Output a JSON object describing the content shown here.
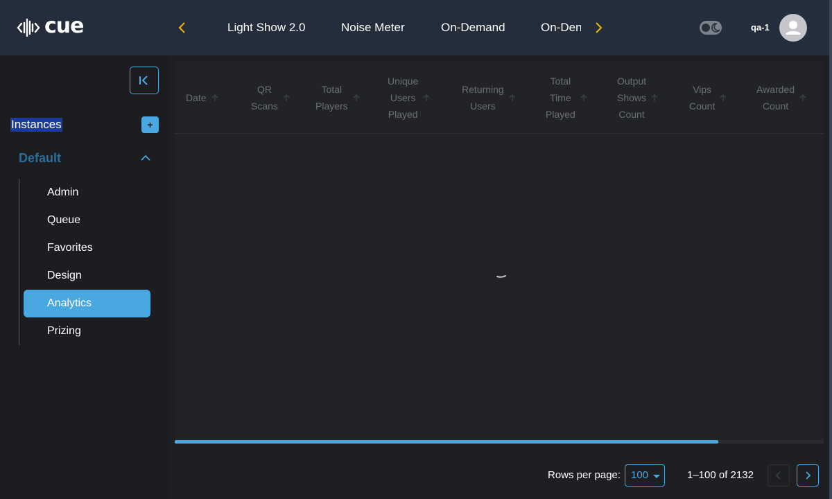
{
  "brand": {
    "name": "cue"
  },
  "header": {
    "tabs": [
      {
        "label": "Light Show 2.0"
      },
      {
        "label": "Noise Meter"
      },
      {
        "label": "On-Demand"
      },
      {
        "label": "On-Den"
      }
    ],
    "username": "qa-1",
    "colors": {
      "arrow": "#f2b705",
      "bar": "#242d3b"
    }
  },
  "sidebar": {
    "instances_label": "Instances",
    "add_label": "+",
    "group": {
      "label": "Default",
      "expanded": true
    },
    "items": [
      {
        "label": "Admin",
        "active": false
      },
      {
        "label": "Queue",
        "active": false
      },
      {
        "label": "Favorites",
        "active": false
      },
      {
        "label": "Design",
        "active": false
      },
      {
        "label": "Analytics",
        "active": true
      },
      {
        "label": "Prizing",
        "active": false
      }
    ]
  },
  "table": {
    "columns": [
      {
        "lines": [
          "Date"
        ]
      },
      {
        "lines": [
          "QR",
          "Scans"
        ]
      },
      {
        "lines": [
          "Total",
          "Players"
        ]
      },
      {
        "lines": [
          "Unique",
          "Users",
          "Played"
        ]
      },
      {
        "lines": [
          "Returning",
          "Users"
        ]
      },
      {
        "lines": [
          "Total",
          "Time",
          "Played"
        ]
      },
      {
        "lines": [
          "Output",
          "Shows",
          "Count"
        ]
      },
      {
        "lines": [
          "Vips",
          "Count"
        ]
      },
      {
        "lines": [
          "Awarded",
          "Count"
        ]
      }
    ],
    "loading": true,
    "horizontal_scroll_fraction": 0.84
  },
  "pagination": {
    "rows_per_page_label": "Rows per page:",
    "rows_per_page_value": "100",
    "range_text": "1–100 of 2132"
  },
  "colors": {
    "accent": "#4aa8e0",
    "group_label": "#2f6d97",
    "header_text": "#6b6e74"
  }
}
